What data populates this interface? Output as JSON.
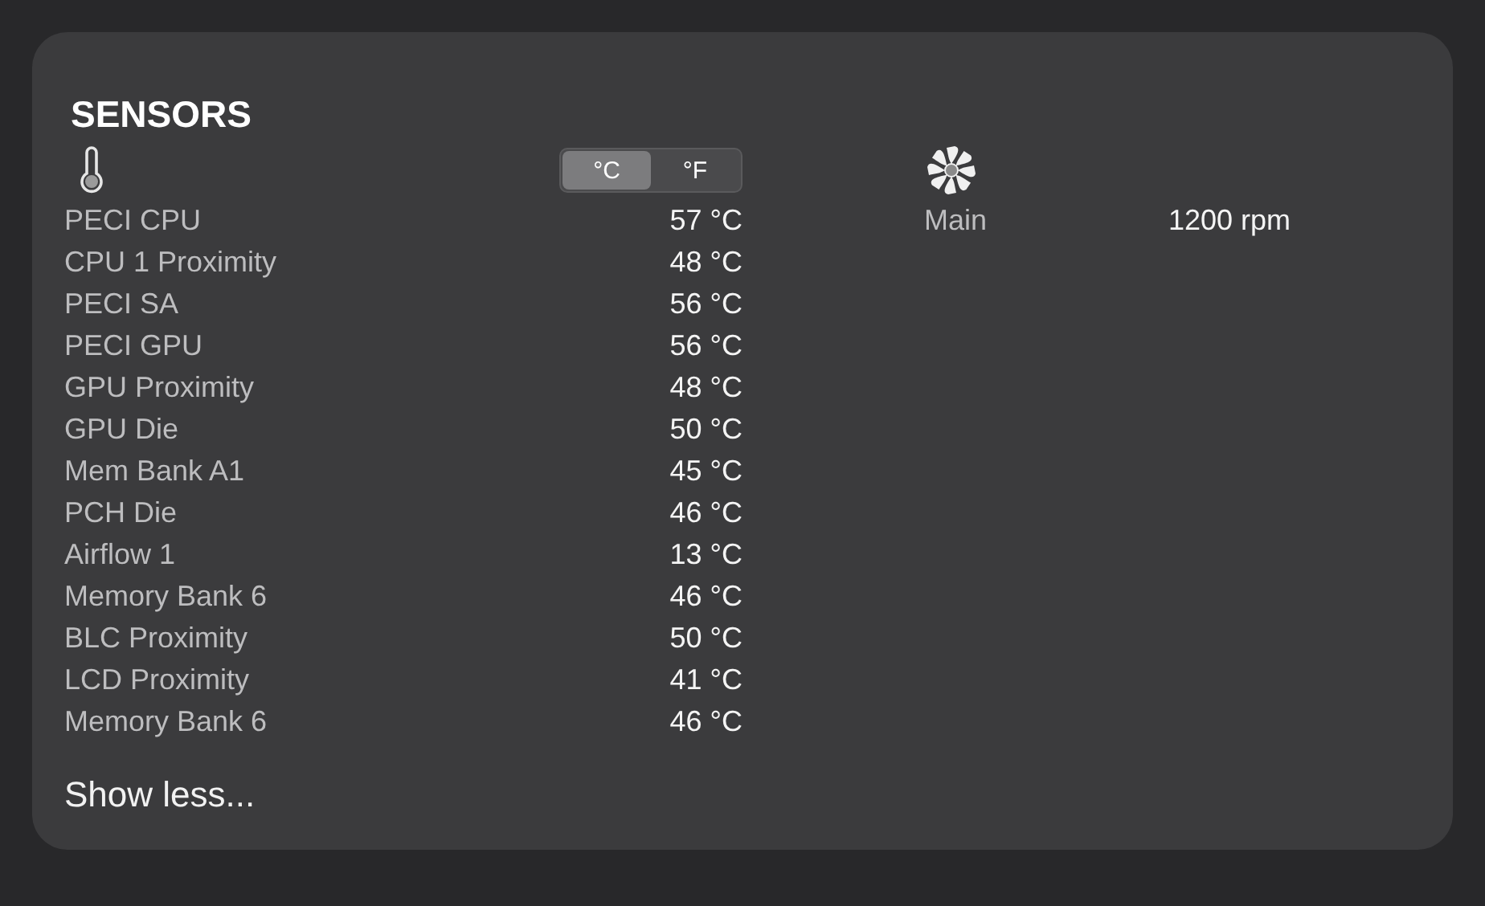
{
  "title": "SENSORS",
  "units": [
    {
      "label": "°C",
      "selected": true
    },
    {
      "label": "°F",
      "selected": false
    }
  ],
  "temperatures": [
    {
      "name": "PECI CPU",
      "value": "57 °C"
    },
    {
      "name": "CPU 1 Proximity",
      "value": "48 °C"
    },
    {
      "name": "PECI SA",
      "value": "56 °C"
    },
    {
      "name": "PECI GPU",
      "value": "56 °C"
    },
    {
      "name": "GPU Proximity",
      "value": "48 °C"
    },
    {
      "name": "GPU Die",
      "value": "50 °C"
    },
    {
      "name": "Mem Bank A1",
      "value": "45 °C"
    },
    {
      "name": "PCH Die",
      "value": "46 °C"
    },
    {
      "name": "Airflow 1",
      "value": "13 °C"
    },
    {
      "name": "Memory Bank 6",
      "value": "46 °C"
    },
    {
      "name": "BLC Proximity",
      "value": "50 °C"
    },
    {
      "name": "LCD Proximity",
      "value": "41 °C"
    },
    {
      "name": "Memory Bank 6",
      "value": "46 °C"
    }
  ],
  "fans": [
    {
      "name": "Main",
      "value": "1200 rpm"
    }
  ],
  "toggle_link": "Show less..."
}
